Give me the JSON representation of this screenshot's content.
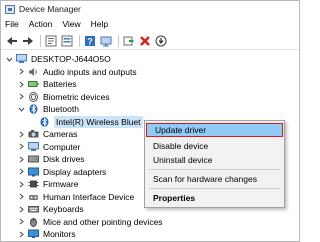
{
  "window": {
    "title": "Device Manager"
  },
  "menu": [
    "File",
    "Action",
    "View",
    "Help"
  ],
  "toolbar_icons": [
    "back-arrow-icon",
    "forward-arrow-icon",
    "properties-icon",
    "list-view-icon",
    "help-icon",
    "monitor-icon",
    "update-driver-icon",
    "remove-device-icon",
    "scan-icon"
  ],
  "tree": {
    "root": "DESKTOP-J644O5O",
    "items": [
      {
        "label": "Audio inputs and outputs",
        "icon": "speaker-icon"
      },
      {
        "label": "Batteries",
        "icon": "battery-icon"
      },
      {
        "label": "Biometric devices",
        "icon": "fingerprint-icon"
      },
      {
        "label": "Bluetooth",
        "icon": "bluetooth-icon",
        "expanded": true
      },
      {
        "label": "Intel(R) Wireless Bluet",
        "icon": "bluetooth-icon",
        "child": true,
        "selected": true
      },
      {
        "label": "Cameras",
        "icon": "camera-icon"
      },
      {
        "label": "Computer",
        "icon": "computer-icon"
      },
      {
        "label": "Disk drives",
        "icon": "disk-icon"
      },
      {
        "label": "Display adapters",
        "icon": "display-icon"
      },
      {
        "label": "Firmware",
        "icon": "chip-icon"
      },
      {
        "label": "Human Interface Device",
        "icon": "hid-icon"
      },
      {
        "label": "Keyboards",
        "icon": "keyboard-icon"
      },
      {
        "label": "Mice and other pointing devices",
        "icon": "mouse-icon"
      },
      {
        "label": "Monitors",
        "icon": "monitor-icon"
      }
    ]
  },
  "context_menu": {
    "items": [
      "Update driver",
      "Disable device",
      "Uninstall device",
      "Scan for hardware changes",
      "Properties"
    ],
    "highlighted": "Update driver",
    "bold": "Properties"
  },
  "colors": {
    "highlight": "#91c9f7",
    "highlight_border": "#e0161b",
    "selection": "#cce4f7"
  }
}
